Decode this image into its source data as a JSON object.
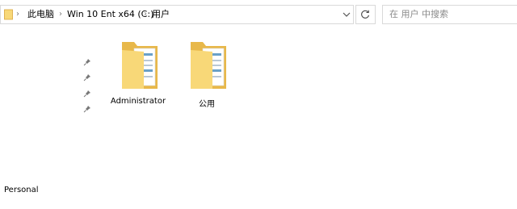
{
  "address_bar": {
    "breadcrumbs": [
      "此电脑",
      "Win 10 Ent x64 (C:)",
      "用户"
    ],
    "dropdown_icon": "chevron-down-icon",
    "refresh_icon": "refresh-icon"
  },
  "search": {
    "placeholder": "在 用户 中搜索",
    "icon": "search-icon"
  },
  "nav_pane": {
    "pinned_count_icons": "pin-icon",
    "bottom_item": "Personal"
  },
  "content": {
    "items": [
      {
        "label": "Administrator",
        "icon": "folder-icon"
      },
      {
        "label": "公用",
        "icon": "folder-icon"
      }
    ]
  },
  "colors": {
    "folder_back": "#E8B84A",
    "folder_front": "#F8D878",
    "border": "#D9D9D9"
  }
}
